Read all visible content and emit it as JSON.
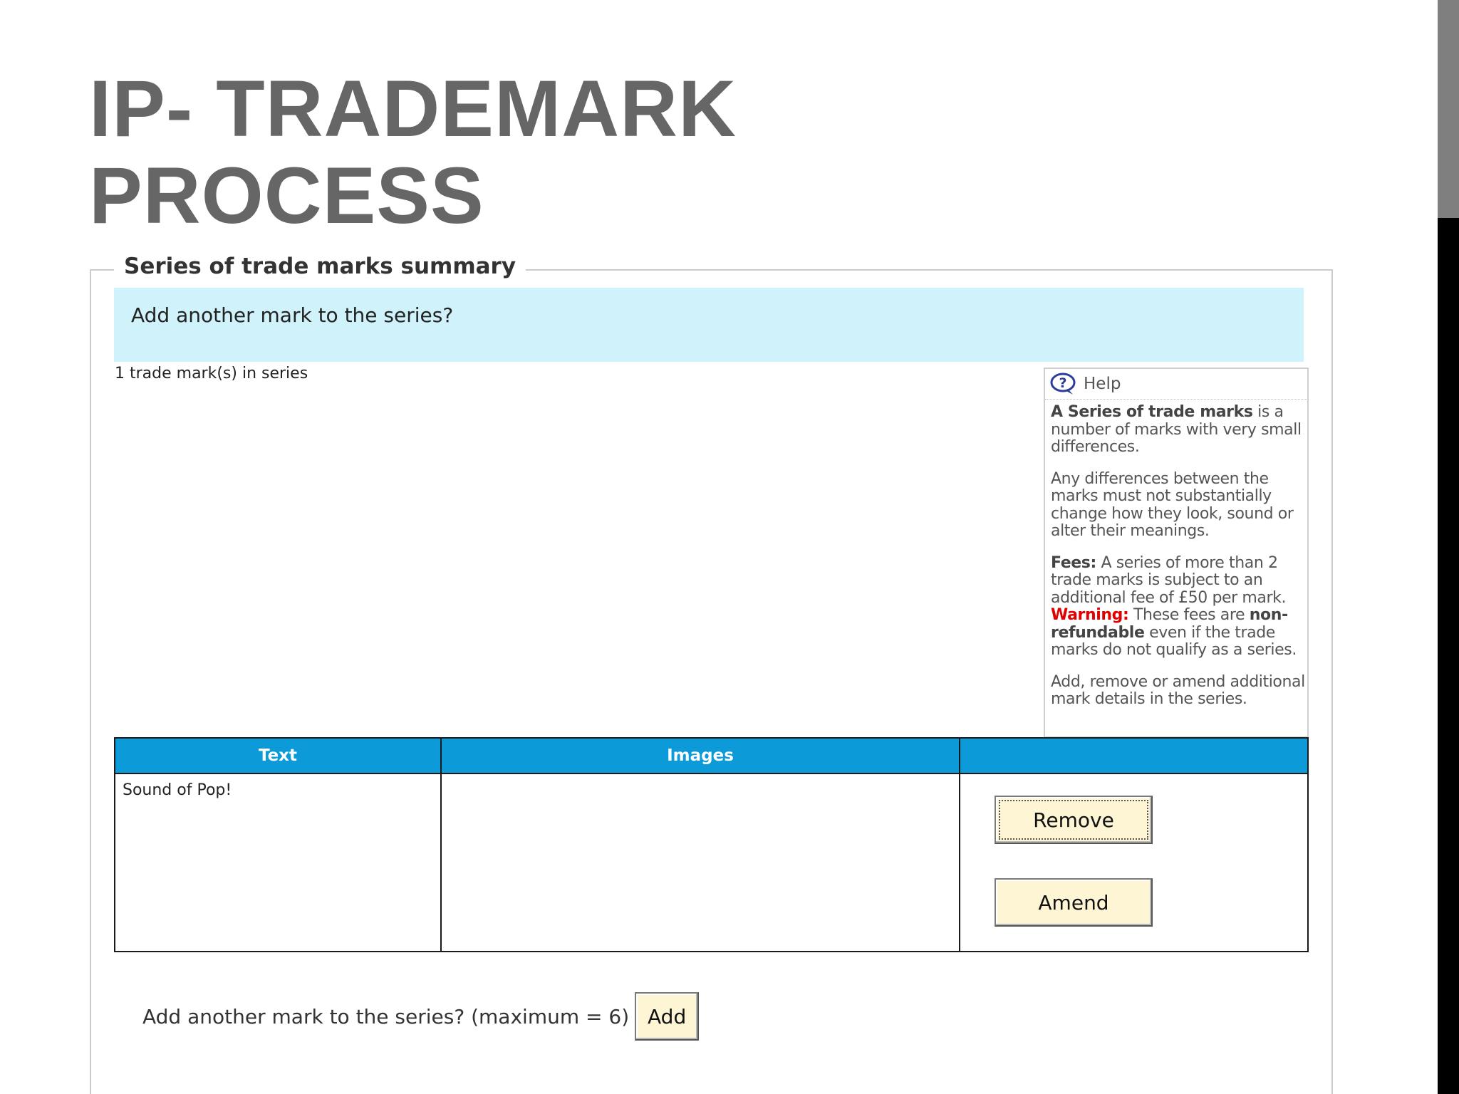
{
  "slide": {
    "title_line1": "IP- TRADEMARK",
    "title_line2": "PROCESS"
  },
  "form": {
    "legend": "Series of trade marks summary",
    "banner_question": "Add another mark to the series?",
    "count_text": "1 trade mark(s) in series"
  },
  "help": {
    "title": "Help",
    "icon": "question-mark-icon",
    "p1_bold": "A Series of trade marks",
    "p1_rest": " is a number of marks with very small differences.",
    "p2": "Any differences between the marks must not substantially change how they look, sound or alter their meanings.",
    "p3_bold": "Fees:",
    "p3_rest": " A series of more than 2 trade marks is subject to an additional fee of £50 per mark.",
    "p3_warning": "Warning:",
    "p3_text2": " These fees are ",
    "p3_bold2": "non-refundable",
    "p3_text3": " even if the trade marks do not qualify as a series.",
    "p4": "Add, remove or amend additional mark details in the series."
  },
  "table": {
    "headers": [
      "Text",
      "Images",
      ""
    ],
    "rows": [
      {
        "text": "Sound of Pop!",
        "images": ""
      }
    ],
    "remove_label": "Remove",
    "amend_label": "Amend"
  },
  "footer": {
    "add_question": "Add another mark to the series? (maximum = 6)",
    "add_label": "Add"
  },
  "colors": {
    "title_grey": "#666666",
    "banner_bg": "#d0f2fb",
    "table_header_bg": "#0c9ad8",
    "button_bg": "#fef5d4",
    "warning_red": "#e00000"
  }
}
